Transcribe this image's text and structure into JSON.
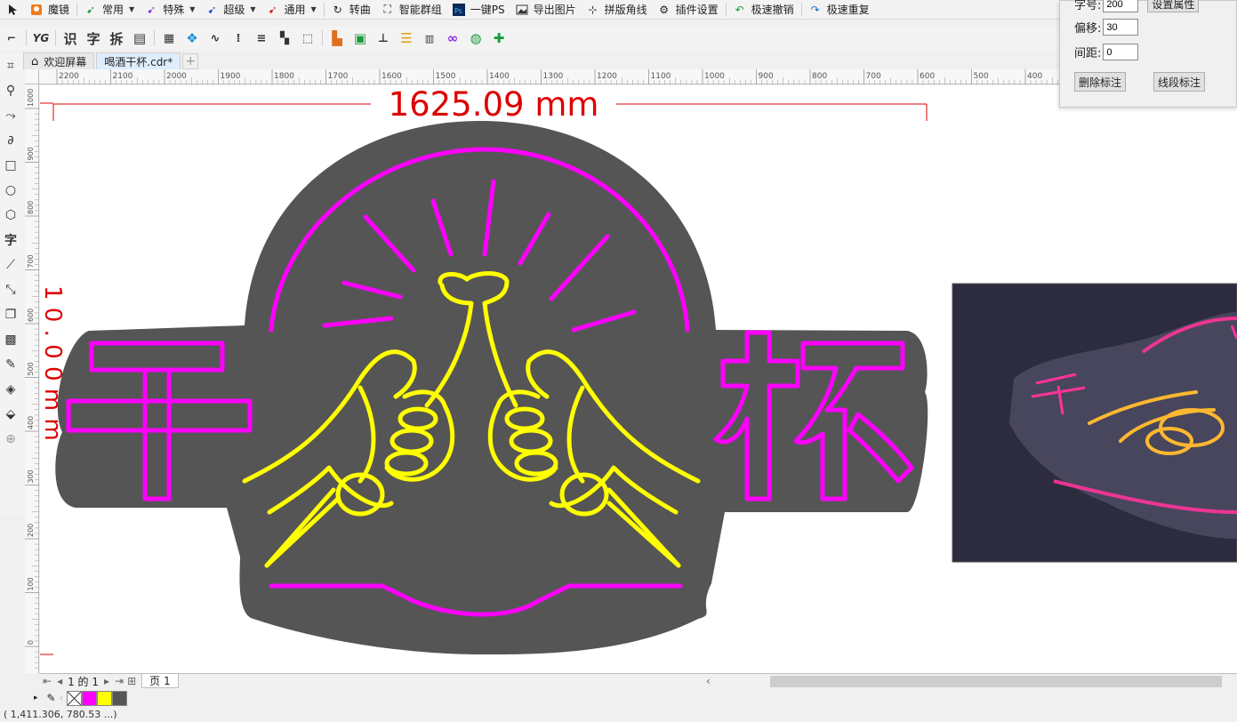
{
  "plugin_bar": {
    "items": [
      {
        "label": "魔镜",
        "icon": "mirror-icon",
        "dropdown": false
      },
      {
        "label": "常用",
        "icon": "pen-green-icon",
        "dropdown": true
      },
      {
        "label": "特殊",
        "icon": "pen-purple-icon",
        "dropdown": true
      },
      {
        "label": "超级",
        "icon": "pen-blue-icon",
        "dropdown": true
      },
      {
        "label": "通用",
        "icon": "pen-red-icon",
        "dropdown": true
      },
      {
        "label": "转曲",
        "icon": "curve-icon",
        "dropdown": false
      },
      {
        "label": "智能群组",
        "icon": "group-icon",
        "dropdown": false
      },
      {
        "label": "一键PS",
        "icon": "ps-icon",
        "dropdown": false
      },
      {
        "label": "导出图片",
        "icon": "image-icon",
        "dropdown": false
      },
      {
        "label": "拼版角线",
        "icon": "crop-mark-icon",
        "dropdown": false
      },
      {
        "label": "插件设置",
        "icon": "gear-icon",
        "dropdown": false
      },
      {
        "label": "极速撤销",
        "icon": "undo-icon",
        "dropdown": false
      },
      {
        "label": "极速重复",
        "icon": "redo-icon",
        "dropdown": false
      }
    ]
  },
  "toolbar2": {
    "text_buttons": [
      "识",
      "字",
      "拆"
    ]
  },
  "tabs": [
    {
      "label": "欢迎屏幕",
      "active": false
    },
    {
      "label": "喝酒干杯.cdr*",
      "active": true
    }
  ],
  "ruler_top": [
    "2200",
    "2100",
    "2000",
    "1900",
    "1800",
    "1700",
    "1600",
    "1500",
    "1400",
    "1300",
    "1200",
    "1100",
    "1000",
    "900",
    "800",
    "700",
    "600",
    "500",
    "400"
  ],
  "ruler_left": [
    "1000",
    "900",
    "800",
    "700",
    "600",
    "500",
    "400",
    "300",
    "200",
    "100",
    "0"
  ],
  "canvas": {
    "width_dimension": "1625.09 mm",
    "height_dimension_partial": "1 0 . 0 0 m m",
    "sign_left_char": "干",
    "sign_right_char": "杯"
  },
  "dialog": {
    "row1_label": "字号:",
    "row1_value": "200",
    "row1_button": "设置属性",
    "row2_label": "偏移:",
    "row2_value": "30",
    "row3_label": "间距:",
    "row3_value": "0",
    "delete_button": "删除标注",
    "segment_button": "线段标注"
  },
  "page_bar": {
    "page_of": "1 的 1",
    "page_tab": "页 1"
  },
  "palette": {
    "colors": [
      "#ff00ff",
      "#ffff00",
      "#555555"
    ]
  },
  "status": {
    "coords": "( 1,411.306, 780.53 ...)"
  },
  "colors": {
    "neon_magenta": "#ff00ff",
    "neon_yellow": "#ffff00",
    "sign_bg": "#555555",
    "dimension_red": "#dd0000"
  }
}
